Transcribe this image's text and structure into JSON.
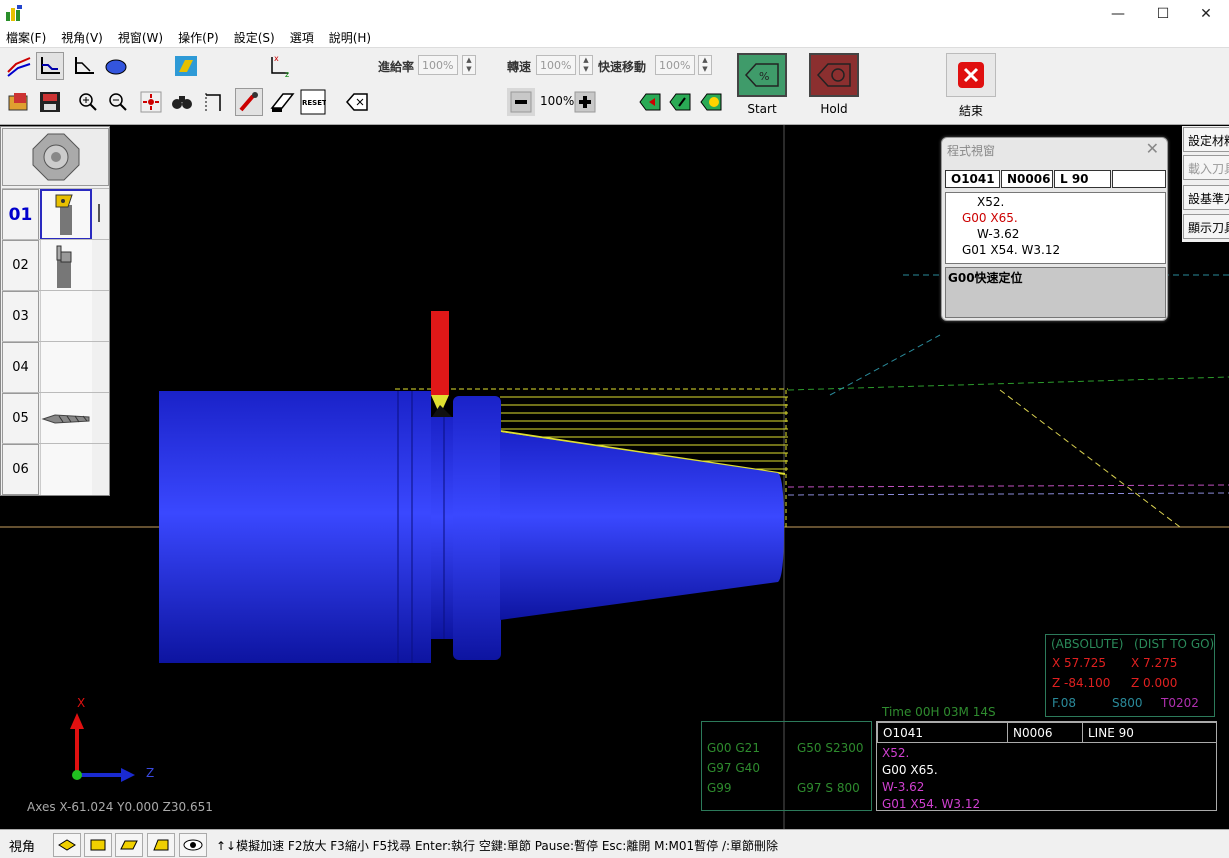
{
  "menu": [
    "檔案(F)",
    "視角(V)",
    "視窗(W)",
    "操作(P)",
    "設定(S)",
    "選項",
    "說明(H)"
  ],
  "window_controls": {
    "minimize": "—",
    "maximize": "☐",
    "close": "✕"
  },
  "toolbar": {
    "feed_label": "進給率",
    "feed_value": "100%",
    "speed_label": "轉速",
    "speed_value": "100%",
    "rapid_label": "快速移動",
    "rapid_value": "100%",
    "sim_speed_value": "100%",
    "start_label": "Start",
    "hold_label": "Hold",
    "end_label": "結束"
  },
  "turret": {
    "tools": [
      {
        "num": "01",
        "active": true,
        "icon": "turning-tool-icon"
      },
      {
        "num": "02",
        "active": false,
        "icon": "grooving-tool-icon"
      },
      {
        "num": "03",
        "active": false,
        "icon": ""
      },
      {
        "num": "04",
        "active": false,
        "icon": ""
      },
      {
        "num": "05",
        "active": false,
        "icon": "drill-icon"
      },
      {
        "num": "06",
        "active": false,
        "icon": ""
      }
    ]
  },
  "program_window": {
    "title": "程式視窗",
    "program": "O1041",
    "block": "N0006",
    "line": "L  90",
    "lines": [
      {
        "text": "X52.",
        "color": "#000000"
      },
      {
        "text": "G00 X65.",
        "color": "#cc0000"
      },
      {
        "text": "W-3.62",
        "color": "#000000"
      },
      {
        "text": "G01 X54. W3.12",
        "color": "#000000"
      }
    ],
    "description": "G00快速定位"
  },
  "right_panel": [
    "設定材料",
    "載入刀具",
    "設基準刀",
    "顯示刀具"
  ],
  "position": {
    "abs_header": "(ABSOLUTE)",
    "dist_header": "(DIST TO GO)",
    "x_abs": "X  57.725",
    "x_dist": "X   7.275",
    "z_abs": "Z -84.100",
    "z_dist": "Z   0.000",
    "feed": "F.08",
    "spindle": "S800",
    "tool": "T0202"
  },
  "time": "Time 00H 03M 14S",
  "gcode_state": {
    "row1_left": "G00  G21",
    "row1_right": "G50 S2300",
    "row2_left": "G97  G40",
    "row3_left": "G99",
    "row3_right": "G97 S 800"
  },
  "nc": {
    "program": "O1041",
    "block": "N0006",
    "line": "LINE  90",
    "lines": [
      {
        "text": "X52.",
        "color": "#d040d0"
      },
      {
        "text": "G00 X65.",
        "color": "#ffffff"
      },
      {
        "text": "W-3.62",
        "color": "#d040d0"
      },
      {
        "text": "G01 X54. W3.12",
        "color": "#d040d0"
      }
    ]
  },
  "axes": {
    "x_label": "X",
    "z_label": "Z",
    "readout": "Axes X-61.024  Y0.000  Z30.651"
  },
  "statusbar": {
    "view_label": "視角",
    "help": "↑↓模擬加速 F2放大 F3縮小 F5找尋  Enter:執行 空鍵:單節 Pause:暫停 Esc:離開  M:M01暫停 /:單節刪除"
  }
}
